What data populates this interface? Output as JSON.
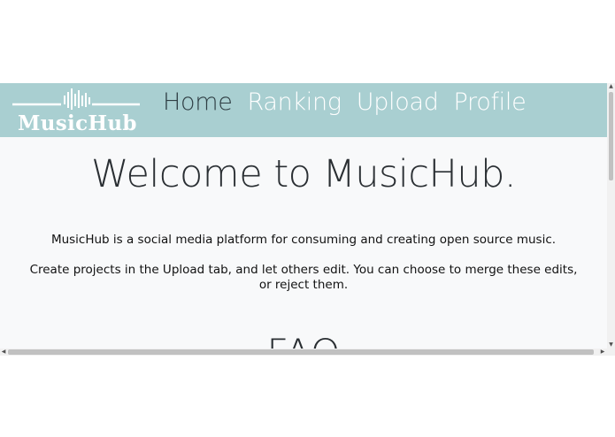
{
  "brand": {
    "name": "MusicHub",
    "logo_icon": "soundwave-icon"
  },
  "nav": {
    "items": [
      {
        "label": "Home",
        "active": true
      },
      {
        "label": "Ranking",
        "active": false
      },
      {
        "label": "Upload",
        "active": false
      },
      {
        "label": "Profile",
        "active": false
      }
    ]
  },
  "main": {
    "heading": "Welcome to MusicHub.",
    "intro": "MusicHub is a social media platform for consuming and creating open source music.",
    "instructions": "Create projects in the Upload tab, and let others edit. You can choose to merge these edits, or reject them.",
    "faq_heading": "FAQ"
  },
  "colors": {
    "navbar_bg": "#a9cfd1",
    "nav_active": "#2f3e44",
    "nav_inactive": "#ffffff",
    "page_bg": "#f8f9fa"
  }
}
